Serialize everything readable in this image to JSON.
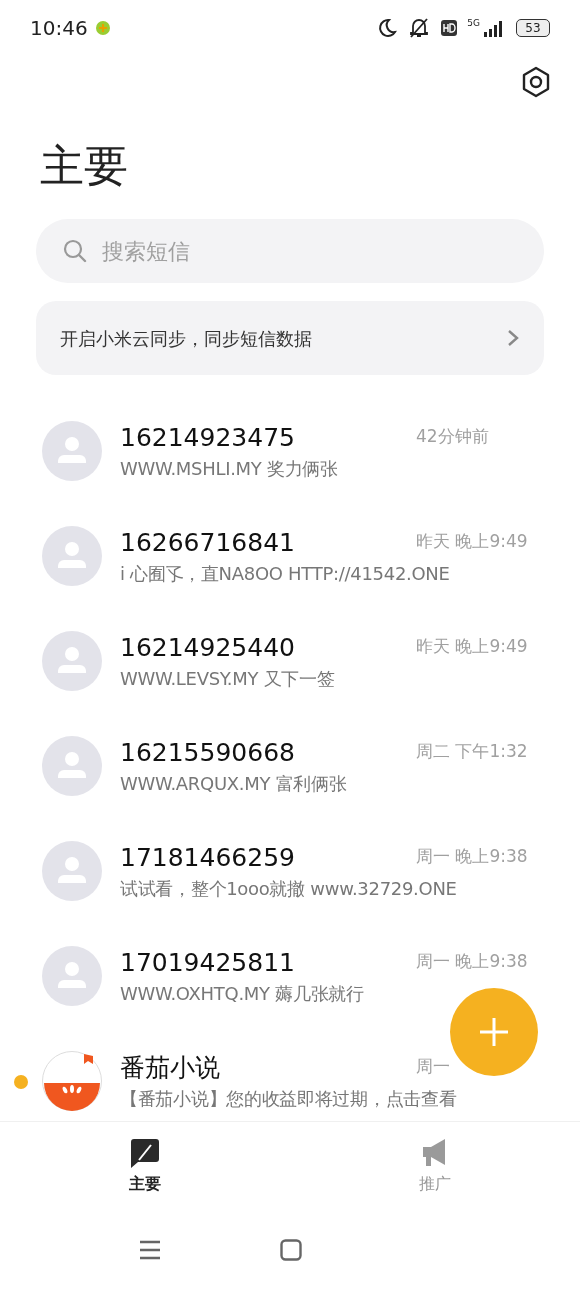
{
  "status_bar": {
    "time": "10:46",
    "network": "5G",
    "battery": "53"
  },
  "title": "主要",
  "search": {
    "placeholder": "搜索短信"
  },
  "sync_banner": {
    "text": "开启小米云同步，同步短信数据"
  },
  "conversations": [
    {
      "name": "16214923475",
      "preview": "WWW.MSHLI.MY   奖力俩张",
      "time": "42分钟前",
      "kind": "contact",
      "unread": false
    },
    {
      "name": "16266716841",
      "preview": "i 心囿孓，直NA8OO  HTTP://41542.ONE",
      "time": "昨天 晚上9:49",
      "kind": "contact",
      "unread": false
    },
    {
      "name": "16214925440",
      "preview": "WWW.LEVSY.MY 又下一签",
      "time": "昨天 晚上9:49",
      "kind": "contact",
      "unread": false
    },
    {
      "name": "16215590668",
      "preview": "WWW.ARQUX.MY  富利俩张",
      "time": "周二 下午1:32",
      "kind": "contact",
      "unread": false
    },
    {
      "name": "17181466259",
      "preview": "试试看，整个1ooo就撤 www.32729.ONE",
      "time": "周一 晚上9:38",
      "kind": "contact",
      "unread": false
    },
    {
      "name": "17019425811",
      "preview": "WWW.OXHTQ.MY    薅几张就行",
      "time": "周一 晚上9:38",
      "kind": "contact",
      "unread": false
    },
    {
      "name": "番茄小说",
      "preview": "【番茄小说】您的收益即将过期，点击查看",
      "time": "周一",
      "kind": "app",
      "unread": true
    }
  ],
  "tabs": [
    {
      "label": "主要",
      "selected": true,
      "kind": "main"
    },
    {
      "label": "推广",
      "selected": false,
      "kind": "promo"
    }
  ]
}
